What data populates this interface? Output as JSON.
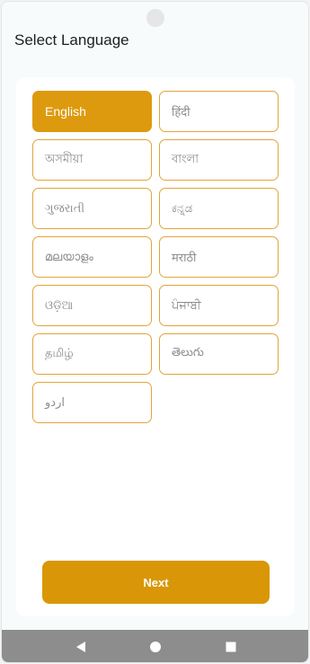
{
  "header": {
    "title": "Select Language"
  },
  "languages": [
    {
      "label": "English",
      "selected": true
    },
    {
      "label": "हिंदी",
      "selected": false
    },
    {
      "label": "অসমীয়া",
      "selected": false
    },
    {
      "label": "বাংলা",
      "selected": false
    },
    {
      "label": "ગુજરાતી",
      "selected": false
    },
    {
      "label": "ಕನ್ನಡ",
      "selected": false
    },
    {
      "label": "മലയാളം",
      "selected": false
    },
    {
      "label": "मराठी",
      "selected": false
    },
    {
      "label": "ଓଡ଼ିଆ",
      "selected": false
    },
    {
      "label": "ਪੰਜਾਬੀ",
      "selected": false
    },
    {
      "label": "தமிழ்",
      "selected": false
    },
    {
      "label": "తెలుగు",
      "selected": false
    },
    {
      "label": "اردو",
      "selected": false
    }
  ],
  "actions": {
    "next_label": "Next"
  },
  "nav": {
    "back_icon": "back-triangle-icon",
    "home_icon": "home-circle-icon",
    "recents_icon": "recents-square-icon"
  },
  "colors": {
    "accent": "#de9a0e",
    "border": "#e3a43a",
    "nav_bar": "#8d8d8d"
  }
}
